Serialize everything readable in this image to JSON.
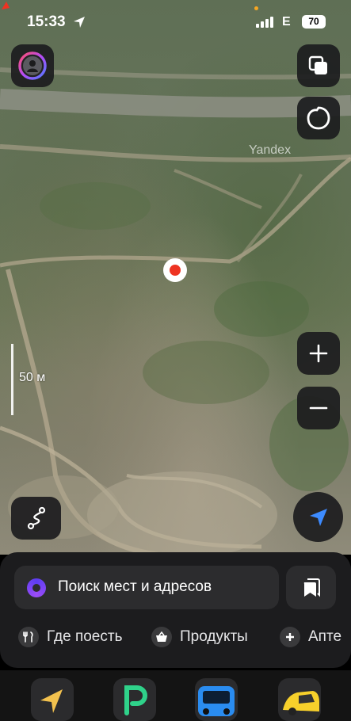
{
  "status_bar": {
    "time": "15:33",
    "network": "E",
    "battery": "70"
  },
  "map": {
    "watermark": "Yandex",
    "scale_label": "50 м"
  },
  "search": {
    "placeholder": "Поиск мест и адресов"
  },
  "chips": [
    {
      "label": "Где поесть",
      "icon": "fork-knife-icon"
    },
    {
      "label": "Продукты",
      "icon": "basket-icon"
    },
    {
      "label": "Апте",
      "icon": "plus-icon"
    }
  ],
  "dock": [
    "navigator-app-icon",
    "parking-app-icon",
    "transport-app-icon",
    "taxi-app-icon"
  ],
  "colors": {
    "pin": "#ee3322",
    "locate_arrow": "#3d8bff",
    "sheet": "#1c1c1e",
    "alice": "#7b3ff5"
  }
}
